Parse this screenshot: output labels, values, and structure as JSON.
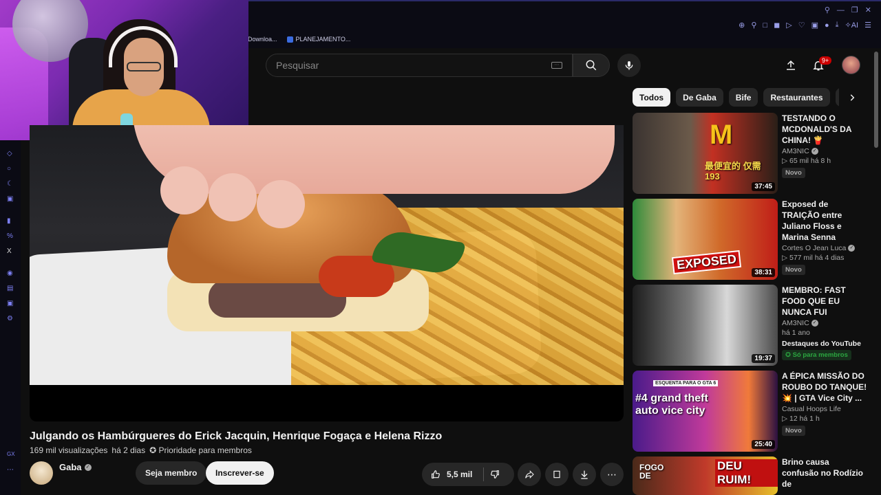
{
  "browser": {
    "bookmarks": [
      {
        "label": "Downloa..."
      },
      {
        "label": "PLANEJAMENTO..."
      }
    ]
  },
  "search": {
    "placeholder": "Pesquisar"
  },
  "header": {
    "notifications_badge": "9+"
  },
  "video": {
    "title": "Julgando os Hambúrgueres do Erick Jacquin, Henrique Fogaça e Helena Rizzo",
    "views": "169 mil visualizações",
    "age": "há 2 dias",
    "priority": "✪ Prioridade para membros",
    "channel": "Gaba",
    "member_label": "Seja membro",
    "subscribe_label": "Inscrever-se",
    "likes": "5,5 mil"
  },
  "chips": [
    {
      "label": "Todos",
      "active": true
    },
    {
      "label": "De Gaba"
    },
    {
      "label": "Bife"
    },
    {
      "label": "Restaurantes"
    },
    {
      "label": "Re"
    }
  ],
  "recommendations": [
    {
      "title": "TESTANDO O MCDONALD'S DA CHINA! 🍟",
      "channel": "AM3NIC",
      "stats": "▷ 65 mil  há 8 h",
      "badge": "Novo",
      "duration": "37:45",
      "thumb_text": "最便宜的 仅需 193"
    },
    {
      "title": "Exposed de TRAIÇÃO entre Juliano Floss e Marina Senna",
      "channel": "Cortes O Jean Luca",
      "stats": "▷ 577 mil  há 4 dias",
      "badge": "Novo",
      "duration": "38:31",
      "thumb_text": "EXPOSED"
    },
    {
      "title": "MEMBRO: FAST FOOD QUE EU NUNCA FUI",
      "channel": "AM3NIC",
      "stats": "há 1 ano",
      "extra": "Destaques do YouTube",
      "members": "✪ Só para membros",
      "duration": "19:37",
      "thumb_text": ""
    },
    {
      "title": "A ÉPICA MISSÃO DO ROUBO DO TANQUE! 💥 | GTA Vice City ...",
      "channel": "Casual Hoops Life",
      "stats": "▷ 12  há 1 h",
      "badge": "Novo",
      "duration": "25:40",
      "thumb_text": "#4 grand theft auto vice city",
      "thumb_sub": "ESQUENTA PARA O GTA 6"
    },
    {
      "title": "Brino causa confusão no Rodízio de",
      "channel": "",
      "stats": "",
      "duration": "",
      "thumb_text": "DEU RUIM!",
      "thumb_sub": "FOGO DE"
    }
  ],
  "colors": {
    "background": "#0f0f0f",
    "chip_active": "#f1f1f1",
    "notif_red": "#cc0000",
    "members_green": "#2ba640"
  }
}
